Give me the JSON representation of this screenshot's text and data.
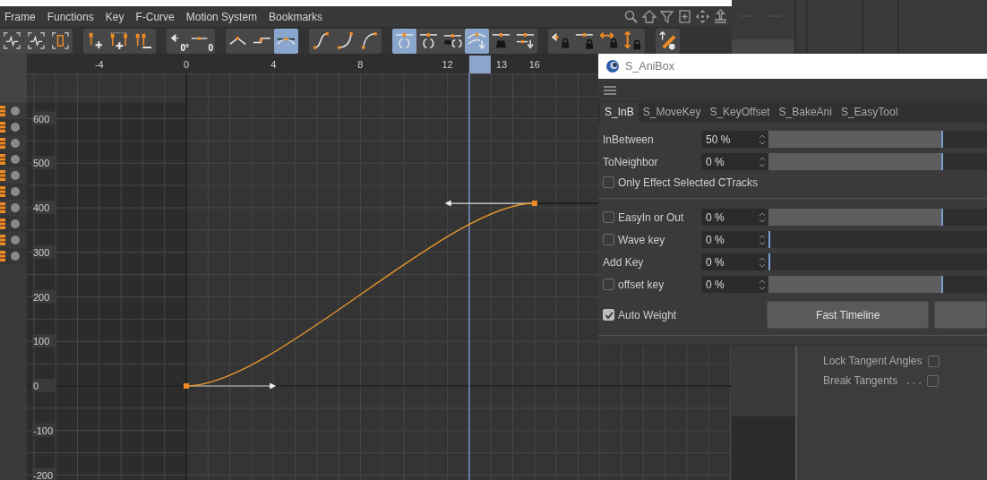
{
  "menu": [
    "Frame",
    "Functions",
    "Key",
    "F-Curve",
    "Motion System",
    "Bookmarks"
  ],
  "toolbar_groups": [
    [
      {
        "kind": "wave",
        "selected": false
      },
      {
        "kind": "wave",
        "selected": false
      },
      {
        "kind": "frame",
        "selected": false
      }
    ],
    [
      {
        "kind": "add-key",
        "selected": false
      },
      {
        "kind": "add-keys",
        "selected": false
      },
      {
        "kind": "remove-key",
        "selected": false
      }
    ],
    [
      {
        "kind": "angle",
        "label": "0°",
        "selected": false
      },
      {
        "kind": "zero",
        "label": "0",
        "selected": false
      }
    ],
    [
      {
        "kind": "peak",
        "selected": false
      },
      {
        "kind": "step",
        "selected": false
      },
      {
        "kind": "ease",
        "selected": true
      }
    ],
    [
      {
        "kind": "s-curve",
        "selected": false
      },
      {
        "kind": "ease-in",
        "selected": false
      },
      {
        "kind": "ease-out",
        "selected": false
      }
    ],
    [
      {
        "kind": "balance",
        "selected": true
      },
      {
        "kind": "balance",
        "selected": false
      },
      {
        "kind": "weight-brackets",
        "selected": false
      },
      {
        "kind": "curves-down",
        "selected": true
      },
      {
        "kind": "weight",
        "selected": false
      },
      {
        "kind": "arrows-down",
        "selected": false
      }
    ],
    [
      {
        "kind": "angle-lock",
        "selected": false
      },
      {
        "kind": "handle-lock",
        "selected": false
      },
      {
        "kind": "h-arrow-lock",
        "selected": false
      },
      {
        "kind": "v-arrow-lock",
        "selected": false
      }
    ],
    [
      {
        "kind": "tool",
        "selected": false
      }
    ]
  ],
  "ruler": {
    "labels": [
      "-4",
      "0",
      "4",
      "8",
      "12",
      "16"
    ],
    "current_frame": "13"
  },
  "value_labels": [
    "600",
    "500",
    "400",
    "300",
    "200",
    "100",
    "0",
    "-100",
    "-200"
  ],
  "window": {
    "title": "S_AniBox",
    "tabs": [
      {
        "label": "S_InB",
        "selected": true
      },
      {
        "label": "S_MoveKey",
        "selected": false
      },
      {
        "label": "S_KeyOffset",
        "selected": false
      },
      {
        "label": "S_BakeAni",
        "selected": false
      },
      {
        "label": "S_EasyTool",
        "selected": false
      }
    ],
    "rows": [
      {
        "kind": "slider",
        "label": "InBetween",
        "value": "50 %",
        "level": 0.8
      },
      {
        "kind": "slider",
        "label": "ToNeighbor",
        "value": "0 %",
        "level": 0.8
      },
      {
        "kind": "check",
        "label": "Only Effect Selected CTracks",
        "checked": false
      },
      {
        "kind": "separator"
      },
      {
        "kind": "slider",
        "label": "EasyIn or Out",
        "checked": false,
        "value": "0 %",
        "level": 0.8
      },
      {
        "kind": "slider",
        "label": "Wave key",
        "checked": false,
        "value": "0 %",
        "level": 0
      },
      {
        "kind": "slider",
        "label": "Add Key",
        "value": "0 %",
        "level": 0
      },
      {
        "kind": "slider",
        "label": "offset key",
        "checked": false,
        "value": "0 %",
        "level": 0.8
      }
    ],
    "footer": {
      "label": "Auto Weight",
      "checked": true,
      "button": "Fast Timeline"
    }
  },
  "side_options": [
    {
      "label": "Lock Tangent Angles",
      "checked": false
    },
    {
      "label": "Break Tangents",
      "suffix": ". . .",
      "checked": false
    }
  ]
}
